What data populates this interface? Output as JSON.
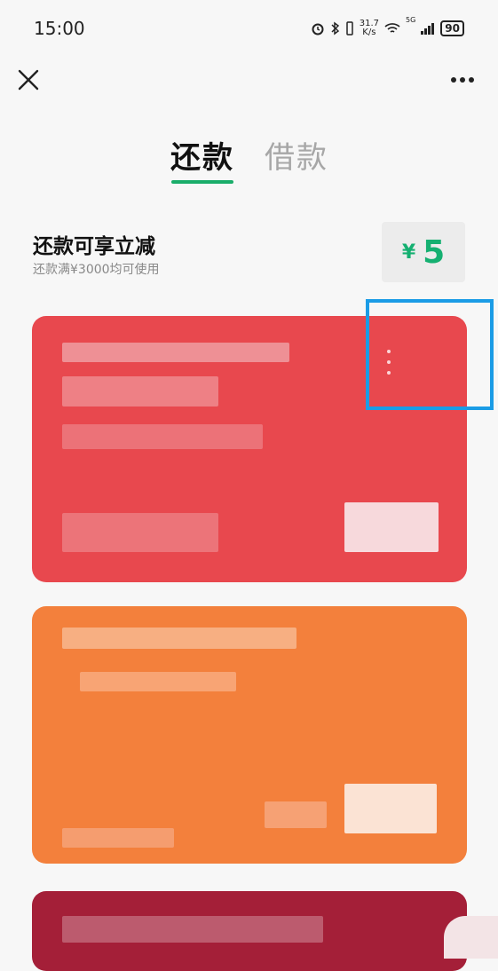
{
  "status_bar": {
    "time": "15:00",
    "net_speed_value": "31.7",
    "net_speed_unit": "K/s",
    "signal_label": "5G",
    "battery": "90",
    "icons": [
      "alarm-icon",
      "bluetooth-icon",
      "vibrate-icon",
      "wifi-icon",
      "signal-icon",
      "battery-icon"
    ]
  },
  "header": {
    "close_icon": "close-icon",
    "more_icon": "more-icon"
  },
  "tabs": [
    {
      "label": "还款",
      "active": true
    },
    {
      "label": "借款",
      "active": false
    }
  ],
  "promo": {
    "title": "还款可享立减",
    "subtitle": "还款满¥3000均可使用",
    "coupon_currency": "¥",
    "coupon_amount": "5"
  },
  "cards": [
    {
      "color": "#e8484e"
    },
    {
      "color": "#f3803c"
    },
    {
      "color": "#a41f38"
    }
  ],
  "colors": {
    "accent_green": "#1aad6a",
    "highlight_blue": "#1b9ce6"
  }
}
